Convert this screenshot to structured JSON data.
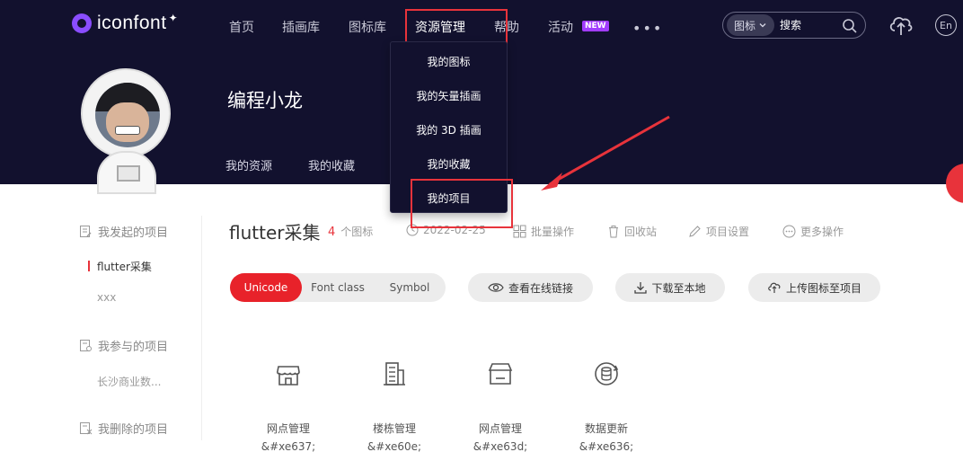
{
  "header": {
    "logo_text": "iconfont",
    "nav": [
      {
        "label": "首页"
      },
      {
        "label": "插画库"
      },
      {
        "label": "图标库"
      },
      {
        "label": "资源管理"
      },
      {
        "label": "帮助"
      },
      {
        "label": "活动"
      }
    ],
    "new_badge": "NEW",
    "more_dots": "•••",
    "search_type": "图标",
    "search_placeholder": "搜索",
    "lang": "En"
  },
  "dropdown": {
    "items": [
      {
        "label": "我的图标"
      },
      {
        "label": "我的矢量插画"
      },
      {
        "label": "我的 3D 插画"
      },
      {
        "label": "我的收藏"
      },
      {
        "label": "我的项目"
      }
    ]
  },
  "profile": {
    "username": "编程小龙",
    "tabs": [
      {
        "label": "我的资源"
      },
      {
        "label": "我的收藏"
      }
    ]
  },
  "sidebar": {
    "sections": [
      {
        "title": "我发起的项目",
        "items": [
          {
            "label": "flutter采集"
          },
          {
            "label": "xxx"
          }
        ]
      },
      {
        "title": "我参与的项目",
        "items": [
          {
            "label": "长沙商业数..."
          }
        ]
      },
      {
        "title": "我删除的项目",
        "items": []
      }
    ]
  },
  "project": {
    "title": "flutter采集",
    "count": "4",
    "count_label": "个图标",
    "date": "2022-02-25",
    "tools": [
      {
        "label": "批量操作"
      },
      {
        "label": "回收站"
      },
      {
        "label": "项目设置"
      },
      {
        "label": "更多操作"
      }
    ],
    "segments": [
      {
        "label": "Unicode"
      },
      {
        "label": "Font class"
      },
      {
        "label": "Symbol"
      }
    ],
    "actions": [
      {
        "label": "查看在线链接"
      },
      {
        "label": "下载至本地"
      },
      {
        "label": "上传图标至项目"
      }
    ],
    "icons": [
      {
        "name": "网点管理",
        "code": "&#xe637;",
        "icon": "storefront-icon"
      },
      {
        "name": "楼栋管理",
        "code": "&#xe60e;",
        "icon": "building-icon"
      },
      {
        "name": "网点管理",
        "code": "&#xe63d;",
        "icon": "shop-icon"
      },
      {
        "name": "数据更新",
        "code": "&#xe636;",
        "icon": "database-refresh-icon"
      }
    ]
  },
  "colors": {
    "header_bg": "#12112e",
    "accent": "#e8333b",
    "brand_purple": "#8a4dff"
  }
}
